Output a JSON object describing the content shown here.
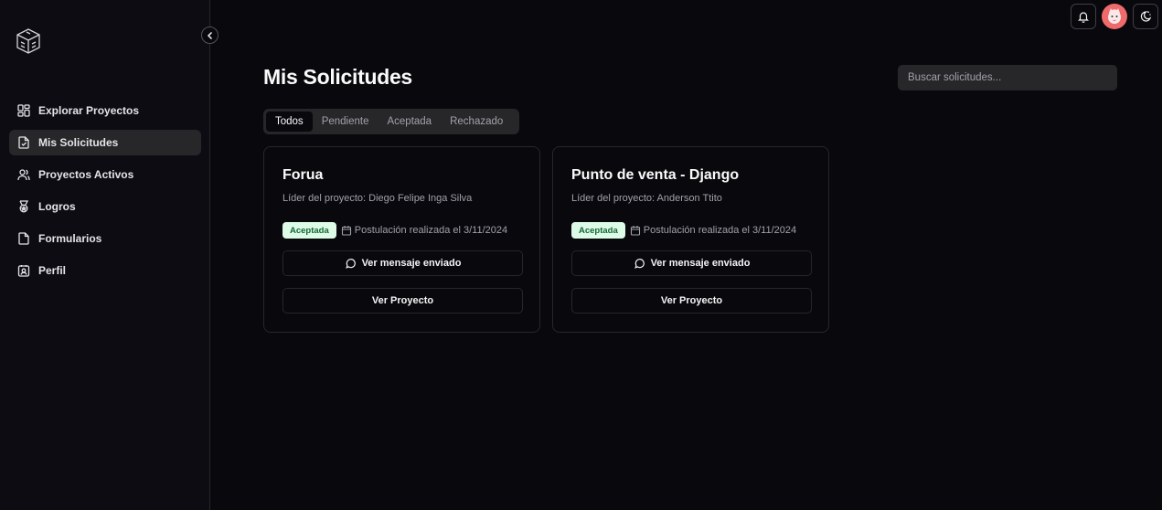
{
  "sidebar": {
    "items": [
      {
        "label": "Explorar Proyectos",
        "icon": "grid-icon",
        "active": false
      },
      {
        "label": "Mis Solicitudes",
        "icon": "file-check-icon",
        "active": true
      },
      {
        "label": "Proyectos Activos",
        "icon": "users-icon",
        "active": false
      },
      {
        "label": "Logros",
        "icon": "medal-icon",
        "active": false
      },
      {
        "label": "Formularios",
        "icon": "file-icon",
        "active": false
      },
      {
        "label": "Perfil",
        "icon": "contact-icon",
        "active": false
      }
    ]
  },
  "header": {
    "title": "Mis Solicitudes",
    "search_placeholder": "Buscar solicitudes..."
  },
  "tabs": [
    {
      "label": "Todos",
      "active": true
    },
    {
      "label": "Pendiente",
      "active": false
    },
    {
      "label": "Aceptada",
      "active": false
    },
    {
      "label": "Rechazado",
      "active": false
    }
  ],
  "cards": [
    {
      "title": "Forua",
      "leader": "Líder del proyecto: Diego Felipe Inga Silva",
      "status": "Aceptada",
      "date": "Postulación realizada el 3/11/2024",
      "message_label": "Ver mensaje enviado",
      "view_label": "Ver Proyecto"
    },
    {
      "title": "Punto de venta - Django",
      "leader": "Líder del proyecto: Anderson Ttito",
      "status": "Aceptada",
      "date": "Postulación realizada el 3/11/2024",
      "message_label": "Ver mensaje enviado",
      "view_label": "Ver Proyecto"
    }
  ],
  "colors": {
    "background": "#09080d",
    "sidebar": "#0d0c13",
    "badge_bg": "#dcfce7",
    "badge_text": "#166534"
  }
}
